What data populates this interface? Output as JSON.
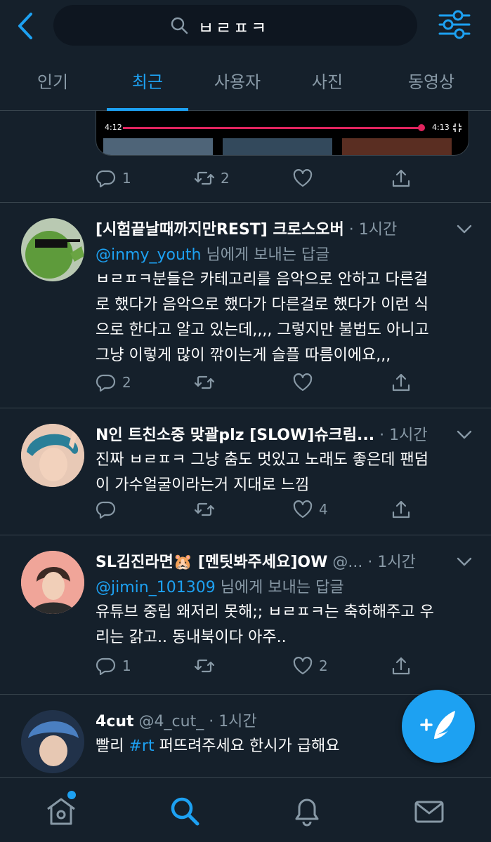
{
  "search": {
    "query": "ㅂㄹㅍㅋ"
  },
  "tabs": [
    {
      "label": "인기",
      "active": false
    },
    {
      "label": "최근",
      "active": true
    },
    {
      "label": "사용자",
      "active": false
    },
    {
      "label": "사진",
      "active": false
    },
    {
      "label": "동영상",
      "active": false
    }
  ],
  "video": {
    "elapsed": "4:12",
    "duration": "4:13",
    "progress": 0.99
  },
  "top_tweet_actions": {
    "replies": "1",
    "retweets": "2",
    "likes": ""
  },
  "tweets": [
    {
      "name": "[시험끝날때까지만REST] 크로스오버",
      "handle": "",
      "time": "1시간",
      "reply_to": "@inmy_youth",
      "reply_suffix": " 님에게 보내는 답글",
      "lines": [
        "ㅂㄹㅍㅋ분들은 카테고리를 음악으로 안하고 다른걸",
        "로 했다가 음악으로 했다가 다른걸로 했다가 이런 식",
        "으로 한다고 알고 있는데,,,, 그렇지만 불법도 아니고",
        "그냥 이렇게 많이 깎이는게 슬플 따름이에요,,,"
      ],
      "replies": "2",
      "retweets": "",
      "likes": ""
    },
    {
      "name": "N인 트친소중 맞괄plz [SLOW]슈크림...",
      "handle": "",
      "time": "1시간",
      "lines": [
        "진짜 ㅂㄹㅍㅋ 그냥 춤도 멋있고 노래도 좋은데 팬덤",
        "이 가수얼굴이라는거 지대로 느낌"
      ],
      "replies": "",
      "retweets": "",
      "likes": "4"
    },
    {
      "name": "SL김진라면🐹 [멘팃봐주세요]OW",
      "handle": "@...",
      "time": "1시간",
      "reply_to": "@jimin_101309",
      "reply_suffix": " 님에게 보내는 답글",
      "lines": [
        "유튜브 중립 왜저리 못해;; ㅂㄹㅍㅋ는 축하해주고 우",
        "리는 갉고.. 동내북이다 아주.."
      ],
      "replies": "1",
      "retweets": "",
      "likes": "2"
    },
    {
      "name": "4cut",
      "handle": "@4_cut_",
      "time": "1시간",
      "text_before": "빨리 ",
      "hashtag": "#rt",
      "text_after": " 퍼뜨려주세요 한시가 급해요"
    }
  ],
  "colors": {
    "background": "#15202b",
    "accent": "#1da1f2",
    "muted": "#8899a6",
    "divider": "#38444d",
    "video_progress": "#e0245e"
  },
  "icons": [
    "back-arrow-icon",
    "search-icon",
    "filter-icon",
    "reply-icon",
    "retweet-icon",
    "like-icon",
    "share-icon",
    "chevron-down-icon",
    "compose-tweet-icon",
    "home-icon",
    "notifications-icon",
    "messages-icon"
  ]
}
